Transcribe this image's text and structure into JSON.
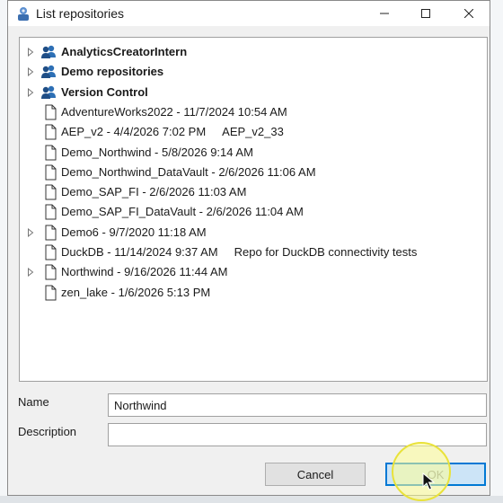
{
  "dialog": {
    "title": "List repositories",
    "name_label": "Name",
    "name_value": "Northwind",
    "description_label": "Description",
    "description_value": "",
    "cancel_label": "Cancel",
    "ok_label": "OK"
  },
  "tree": {
    "items": [
      {
        "label": "AnalyticsCreatorIntern",
        "desc": "",
        "icon": "group-folder-icon",
        "expandable": true,
        "bold": true
      },
      {
        "label": "Demo repositories",
        "desc": "",
        "icon": "group-folder-icon",
        "expandable": true,
        "bold": true
      },
      {
        "label": "Version Control",
        "desc": "",
        "icon": "group-folder-icon",
        "expandable": true,
        "bold": true
      },
      {
        "label": "AdventureWorks2022 - 11/7/2024 10:54 AM",
        "desc": "",
        "icon": "document-icon",
        "expandable": false,
        "bold": false
      },
      {
        "label": "AEP_v2 - 4/4/2026 7:02 PM",
        "desc": "AEP_v2_33",
        "icon": "document-icon",
        "expandable": false,
        "bold": false
      },
      {
        "label": "Demo_Northwind - 5/8/2026 9:14 AM",
        "desc": "",
        "icon": "document-icon",
        "expandable": false,
        "bold": false
      },
      {
        "label": "Demo_Northwind_DataVault - 2/6/2026 11:06 AM",
        "desc": "",
        "icon": "document-icon",
        "expandable": false,
        "bold": false
      },
      {
        "label": "Demo_SAP_FI - 2/6/2026 11:03 AM",
        "desc": "",
        "icon": "document-icon",
        "expandable": false,
        "bold": false
      },
      {
        "label": "Demo_SAP_FI_DataVault - 2/6/2026 11:04 AM",
        "desc": "",
        "icon": "document-icon",
        "expandable": false,
        "bold": false
      },
      {
        "label": "Demo6 - 9/7/2020 11:18 AM",
        "desc": "",
        "icon": "document-icon",
        "expandable": true,
        "bold": false
      },
      {
        "label": "DuckDB - 11/14/2024 9:37 AM",
        "desc": "Repo for DuckDB connectivity tests",
        "icon": "document-icon",
        "expandable": false,
        "bold": false
      },
      {
        "label": "Northwind - 9/16/2026 11:44 AM",
        "desc": "",
        "icon": "document-icon",
        "expandable": true,
        "bold": false
      },
      {
        "label": "zen_lake - 1/6/2026 5:13 PM",
        "desc": "",
        "icon": "document-icon",
        "expandable": false,
        "bold": false
      }
    ]
  },
  "colors": {
    "accent": "#0078d4",
    "group_icon": "#2d6fb5",
    "highlight": "#fff59a"
  }
}
